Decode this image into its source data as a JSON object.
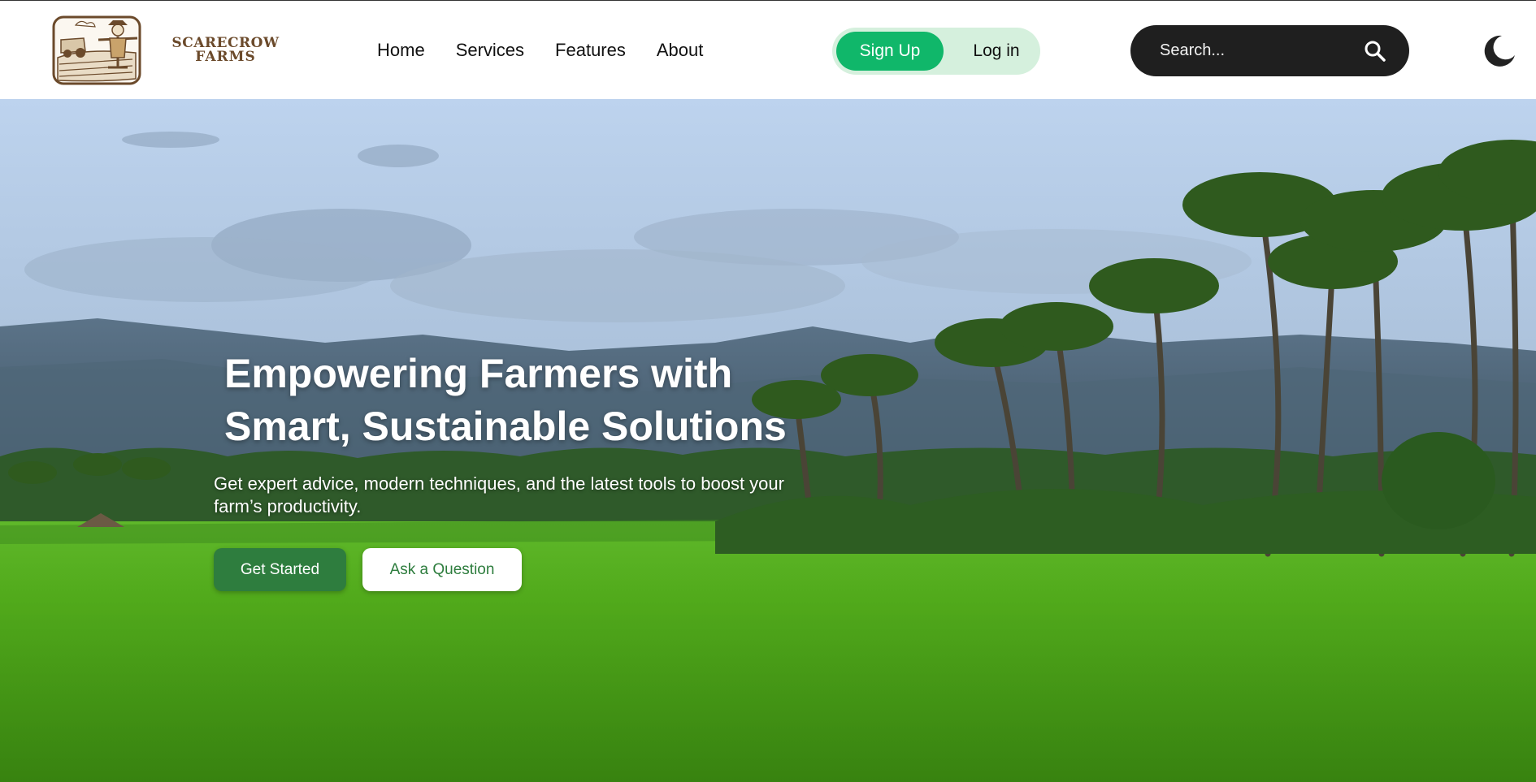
{
  "header": {
    "brand_line1": "SCARECROW",
    "brand_line2": "FARMS",
    "nav": [
      {
        "label": "Home"
      },
      {
        "label": "Services"
      },
      {
        "label": "Features"
      },
      {
        "label": "About"
      }
    ],
    "signup_label": "Sign Up",
    "login_label": "Log in",
    "search_placeholder": "Search...",
    "icons": {
      "search": "search-icon",
      "theme": "moon-icon"
    }
  },
  "hero": {
    "title_line1": "Empowering Farmers with",
    "title_line2": "Smart, Sustainable Solutions",
    "subtitle": "Get expert advice, modern techniques, and the latest tools to boost your farm’s productivity.",
    "primary_button": "Get Started",
    "secondary_button": "Ask a Question"
  },
  "colors": {
    "brand_brown": "#6b4a2b",
    "signup_green": "#10b76a",
    "auth_bg": "#d5f0dd",
    "search_bg": "#1f1f1f",
    "primary_button": "#2e7d3e"
  }
}
